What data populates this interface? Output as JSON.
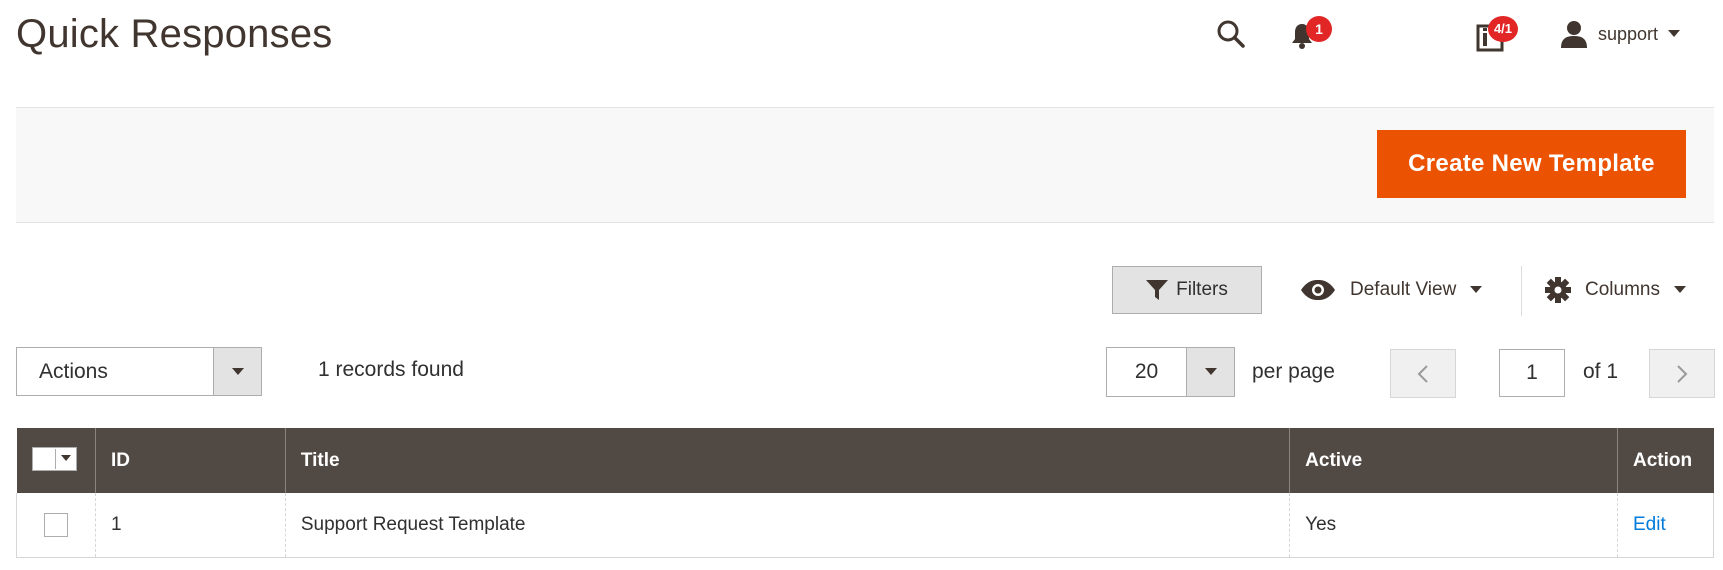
{
  "page": {
    "title": "Quick Responses"
  },
  "header": {
    "notifications_count": "1",
    "system_messages_count": "4/1",
    "user_name": "support"
  },
  "actions": {
    "create_label": "Create New Template"
  },
  "toolbar": {
    "filters_label": "Filters",
    "view_label": "Default View",
    "columns_label": "Columns",
    "mass_action_label": "Actions",
    "records_found": "1 records found",
    "per_page_value": "20",
    "per_page_label": "per page",
    "current_page": "1",
    "total_pages_label": "of 1"
  },
  "grid": {
    "columns": [
      "ID",
      "Title",
      "Active",
      "Action"
    ],
    "rows": [
      {
        "id": "1",
        "title": "Support Request Template",
        "active": "Yes",
        "action": "Edit"
      }
    ]
  },
  "colors": {
    "accent": "#eb5202",
    "header_bg": "#514943",
    "badge": "#e22626",
    "link": "#007bdb"
  },
  "icons": [
    "search-icon",
    "bell-icon",
    "system-messages-icon",
    "user-icon",
    "chevron-down-icon",
    "filter-icon",
    "eye-icon",
    "gear-icon",
    "chevron-left-icon",
    "chevron-right-icon"
  ]
}
